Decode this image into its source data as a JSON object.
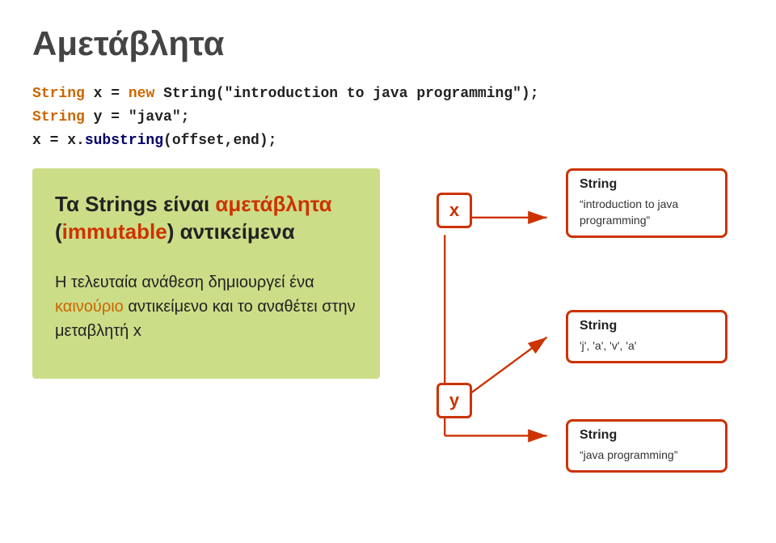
{
  "title": "Αμετάβλητα",
  "code": {
    "line1_pre": "String x = ",
    "line1_new": "new",
    "line1_post": " String(\"introduction to java programming\");",
    "line2_pre": "String y = \"java\";",
    "line3_pre": "x = x.",
    "line3_method": "substring",
    "line3_post": "(offset,end);"
  },
  "left_panel": {
    "main_text_part1": "Τα Strings είναι ",
    "main_text_highlight": "αμετάβλητα",
    "main_text_part2": "(immutable)",
    "main_text_part3": " αντικείμενα",
    "sub_text_part1": "Η τελευταία ανάθεση δημιουργεί ένα ",
    "sub_text_highlight": "καινούριο",
    "sub_text_part2": " αντικείμενο και το αναθέτει στην μεταβλητή x"
  },
  "diagram": {
    "var_x": "x",
    "var_y": "y",
    "box1_header": "String",
    "box1_content": "“introduction to java programming”",
    "box2_header": "String",
    "box2_content": "'j', 'a', 'v', 'a'",
    "box3_header": "String",
    "box3_content": "“java programming”"
  },
  "colors": {
    "accent_red": "#cc3300",
    "accent_orange": "#cc6600",
    "green_bg": "#ccdd88",
    "dark_blue": "#000066"
  }
}
